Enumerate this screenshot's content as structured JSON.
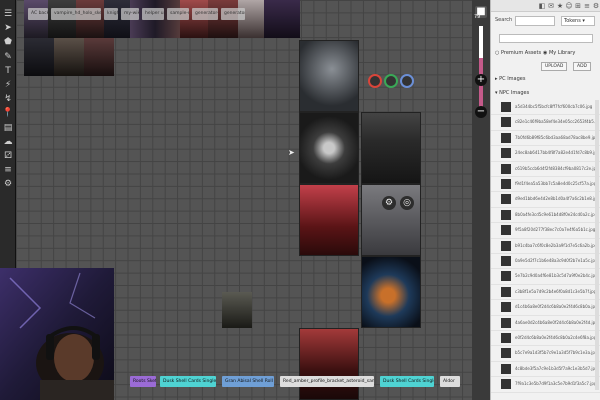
{
  "toolbar": {
    "tools": [
      "menu-icon",
      "cursor-icon",
      "shape-icon",
      "brush-icon",
      "text-icon",
      "fog-icon",
      "ruler-icon",
      "pin-icon",
      "layer-icon",
      "cloud-icon",
      "dice-icon",
      "journal-icon",
      "settings-icon"
    ],
    "glyphs": [
      "☰",
      "➤",
      "⬟",
      "✎",
      "T",
      "⚡",
      "↯",
      "📍",
      "▤",
      "☁",
      "⚂",
      "≡",
      "⚙"
    ]
  },
  "map": {
    "tab_chips": [
      "AC back",
      "vampire_hd_holo_sketch",
      "knight",
      "my-wiki",
      "helper ui",
      "sample-map",
      "generator-thing",
      "generator-thing"
    ],
    "bottom_tags": [
      "Roots Sketch",
      "Dusk Shell Cards Single Sheet",
      "Gran Abisal Shell Roll Cards",
      "Red_amber_profile_bracket_asteroid_sample_single",
      "Dusk Shell Cards Single Sheet",
      "Aldor"
    ],
    "bottom_tag_colors": [
      "#9b6bd6",
      "#4fd3d3",
      "#6f9fd6",
      "#dddddd",
      "#4fd3d3",
      "#dddddd"
    ],
    "ring_colors": [
      "#d9453a",
      "#3aa857",
      "#6b8fd6"
    ]
  },
  "zoom": {
    "value": "79",
    "level": 0.62
  },
  "panel": {
    "tabs": [
      "◧",
      "✉",
      "★",
      "☺",
      "⊞",
      "≡",
      "⚙"
    ],
    "search_label": "Search",
    "search_value": "",
    "search_select": "Tokens",
    "premium_label": "Premium Assets",
    "library_label": "My Library",
    "upload_label": "UPLOAD",
    "add_label": "ADD",
    "pc_header": "PC Images",
    "npc_header": "NPC Images",
    "files": [
      "a5d344bc5f5bcfc8ff7fcf600cb7c06.jpg",
      "c82e1c46f9ba58ef4e34e05cc2653f4b5.jpg",
      "7b0fd6b89f85c6bd3aa68ad78ac8be9.jpg",
      "24ec8ab6417bb4f8f7a82e4d1fd7c8b9.jpg",
      "c619b5ccb6d4f2fd8384cf9ba0817c2e.jpg",
      "f9d1f4ea5a53bb7c5a8e4d0c25cf57a.jpg",
      "d9ed1bbd6e4d2e8b1d0a4f7a6c2b1e8.jpg",
      "8b0a4fe3cd5c9e61b4d8f0e24cd0a2c.jpg",
      "9f5a8f20d277f38ec7c0a7e4f6a5b1c.jpg",
      "b91c4ba7c6f0c8e2b3a9f1d7e5c6a2b.jpg",
      "0a9e5d2f7c1b6e48a3c9d0f2b7e1a5c.jpg",
      "5e7b2c9d0a4f6e81b3c5d7a9f0e2b4c.jpg",
      "c3b8f1e5a7d9c2b4e6f0a8d1c3e5b7f.jpg",
      "d1c4b6a8e0f2d4c6b8a0e2f4d6c8b0a.jpg",
      "4a6ae0d2c4b6a8e0f2d4c6b8a0e2f4d.jpg",
      "e0f2d4c6b8a0e2f4d6c8b0a2c4e6f8a.jpg",
      "b5c7e9a1d3f5b7c9e1a3d5f7b9c1e3a.jpg",
      "4c8bde3f5a7c9e1b3d5f7a9c1e3b5d7.jpg",
      "7f9a1c3e5b7d9f1a3c5e7b9d1f3a5c7.jpg"
    ]
  }
}
